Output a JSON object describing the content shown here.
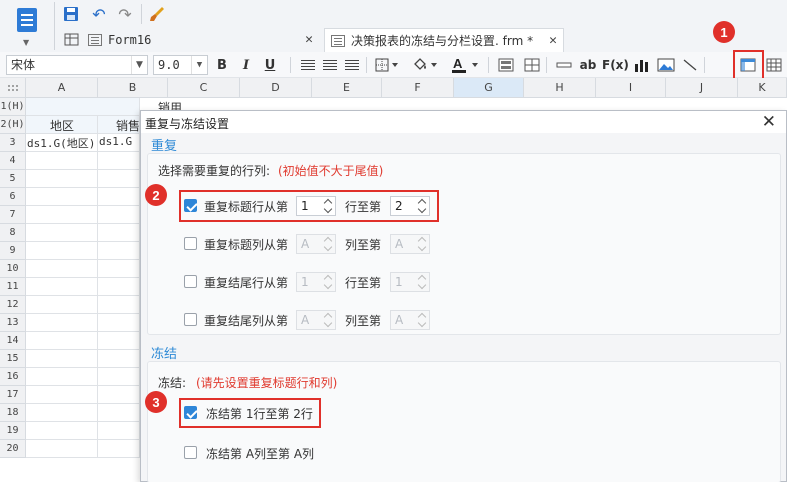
{
  "window": {
    "tabs": [
      {
        "label": "Form16"
      },
      {
        "label": "决策报表的冻结与分栏设置. frm *"
      }
    ]
  },
  "toolbar": {
    "font_name": "宋体",
    "font_size": "9.0",
    "bold": "B",
    "italic": "I",
    "underline": "U",
    "text_ab": "ab",
    "formula": "F(x)"
  },
  "sheet": {
    "columns": [
      "A",
      "B",
      "C",
      "D",
      "E",
      "F",
      "G",
      "H",
      "I",
      "J",
      "K"
    ],
    "rows": [
      "1(H)",
      "2(H)",
      "3",
      "4",
      "5",
      "6",
      "7",
      "8",
      "9",
      "10",
      "11",
      "12",
      "13",
      "14",
      "15",
      "16",
      "17",
      "18",
      "19",
      "20"
    ],
    "cells": {
      "r1_sales": "销用",
      "r2_region": "地区",
      "r2_sales": "销售",
      "r3_a": "ds1.G(地区)",
      "r3_b": "ds1.G"
    }
  },
  "annotations": [
    "1",
    "2",
    "3"
  ],
  "dialog": {
    "title": "重复与冻结设置",
    "repeat": {
      "section": "重复",
      "prompt": "选择需要重复的行列:",
      "note": "(初始值不大于尾值)",
      "options": [
        {
          "label": "重复标题行从第",
          "checked": true,
          "from": "1",
          "to_label": "行至第",
          "to": "2"
        },
        {
          "label": "重复标题列从第",
          "checked": false,
          "from": "A",
          "to_label": "列至第",
          "to": "A"
        },
        {
          "label": "重复结尾行从第",
          "checked": false,
          "from": "1",
          "to_label": "行至第",
          "to": "1"
        },
        {
          "label": "重复结尾列从第",
          "checked": false,
          "from": "A",
          "to_label": "列至第",
          "to": "A"
        }
      ]
    },
    "freeze": {
      "section": "冻结",
      "prompt": "冻结:",
      "note": "(请先设置重复标题行和列)",
      "options": [
        {
          "label": "冻结第 1行至第 2行",
          "checked": true
        },
        {
          "label": "冻结第 A列至第 A列",
          "checked": false
        }
      ]
    }
  },
  "colors": {
    "accent_blue": "#2e86d8",
    "annotation_red": "#e0302a",
    "note_red": "#e03a2f",
    "section_blue": "#2e8ad6"
  }
}
